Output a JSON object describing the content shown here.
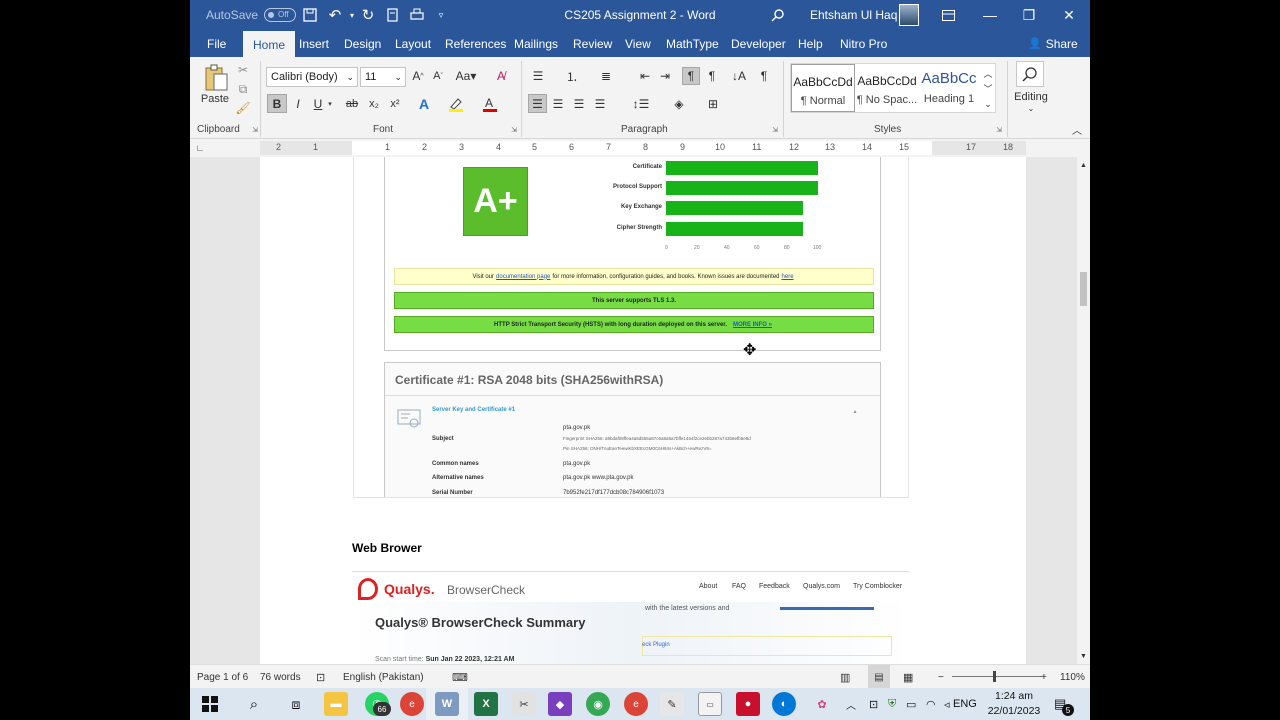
{
  "titlebar": {
    "autosave_label": "AutoSave",
    "autosave_state": "Off",
    "doc_title": "CS205 Assignment 2  -  Word",
    "user_name": "Ehtsham Ul Haq",
    "min": "—",
    "restore": "❐",
    "close": "✕"
  },
  "tabs": [
    "File",
    "Home",
    "Insert",
    "Design",
    "Layout",
    "References",
    "Mailings",
    "Review",
    "View",
    "MathType",
    "Developer",
    "Help",
    "Nitro Pro"
  ],
  "share_label": "Share",
  "ribbon": {
    "paste_label": "Paste",
    "clipboard_label": "Clipboard",
    "font_label": "Font",
    "paragraph_label": "Paragraph",
    "styles_label": "Styles",
    "font_name": "Calibri (Body)",
    "font_size": "11",
    "bold": "B",
    "italic": "I",
    "underline": "U",
    "styles": [
      {
        "sample": "AaBbCcDd",
        "name": "¶ Normal"
      },
      {
        "sample": "AaBbCcDd",
        "name": "¶ No Spac..."
      },
      {
        "sample": "AaBbCc",
        "name": "Heading 1"
      }
    ],
    "editing_label": "Editing"
  },
  "ruler_ticks": [
    "2",
    "1",
    "1",
    "2",
    "3",
    "4",
    "5",
    "6",
    "7",
    "8",
    "9",
    "10",
    "11",
    "12",
    "13",
    "14",
    "15",
    "17",
    "18"
  ],
  "ssl_report": {
    "grade": "A+",
    "bars": [
      {
        "label": "Certificate",
        "value": 100
      },
      {
        "label": "Protocol Support",
        "value": 100
      },
      {
        "label": "Key Exchange",
        "value": 90
      },
      {
        "label": "Cipher Strength",
        "value": 90
      }
    ],
    "axis_ticks": [
      "0",
      "20",
      "40",
      "60",
      "80",
      "100"
    ],
    "notice_pre": "Visit our",
    "notice_link": "documentation page",
    "notice_post": "for more information, configuration guides, and books. Known issues are documented",
    "notice_here": "here",
    "tls_notice": "This server supports TLS 1.3.",
    "hsts_notice": "HTTP Strict Transport Security (HSTS) with long duration deployed on this server.",
    "hsts_more": "MORE INFO »",
    "cert_title": "Certificate #1: RSA 2048 bits (SHA256withRSA)",
    "server_key_head": "Server Key and Certificate #1",
    "subject_label": "Subject",
    "subject_value": "pta.gov.pk",
    "fingerprint": "Fingerprint SHA256: a9bdaf08ffea4a5d555a87c6a8a9a7bffe1454f2ce2ebb287a743b8efb6e8d",
    "pin": "Pin SHA256: ONH/TnuEanTeewiKbXEEcGM0C6H84s+AkBch+ewRezV8=",
    "common_label": "Common names",
    "common_value": "pta.gov.pk",
    "alt_label": "Alternative names",
    "alt_value": "pta.gov.pk www.pta.gov.pk",
    "serial_label": "Serial Number",
    "serial_value": "7b952fe217df177dcb08c784906f1073"
  },
  "heading_web": "Web Brower",
  "qualys": {
    "brand": "Qualys.",
    "product": "BrowserCheck",
    "nav": [
      "About",
      "FAQ",
      "Feedback",
      "Qualys.com",
      "Try Comblocker"
    ],
    "title": "Qualys® BrowserCheck Summary",
    "scan_label": "Scan start time:",
    "scan_time": "Sun Jan 22 2023, 12:21 AM",
    "faded_text": "with the latest versions and",
    "plugin_text": "eck Plugin"
  },
  "statusbar": {
    "page": "Page 1 of 6",
    "words": "76 words",
    "language": "English (Pakistan)",
    "zoom": "110%",
    "zoom_minus": "−",
    "zoom_plus": "+"
  },
  "taskbar": {
    "whatsapp_badge": "66",
    "lang": "ENG",
    "time": "1:24 am",
    "date": "22/01/2023",
    "notif_count": "5"
  }
}
